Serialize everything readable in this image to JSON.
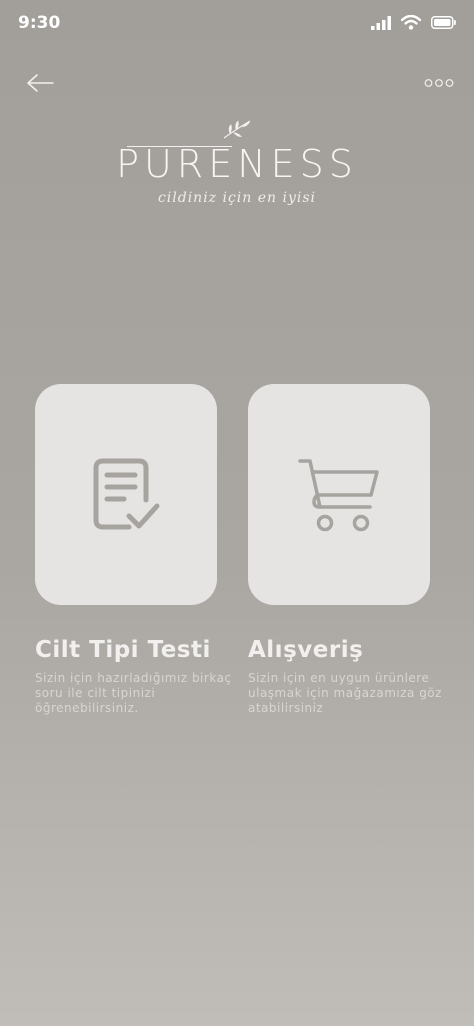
{
  "status_bar": {
    "time": "9:30"
  },
  "brand": {
    "name": "PURENESS",
    "tagline": "cildiniz için en iyisi"
  },
  "cards": [
    {
      "title": "Cilt Tipi Testi",
      "description": "Sizin için hazırladığımız birkaç soru ile cilt tipinizi öğrenebilirsiniz.",
      "icon": "document-check-icon"
    },
    {
      "title": "Alışveriş",
      "description": "Sizin için en uygun ürünlere ulaşmak için mağazamıza göz atabilirsiniz",
      "icon": "shopping-cart-icon"
    }
  ],
  "colors": {
    "background_top": "#a29e9a",
    "background_bottom": "#c0bdb9",
    "card": "#e5e4e3",
    "icon": "#a7a39f",
    "text_light": "#f2f0ee"
  }
}
